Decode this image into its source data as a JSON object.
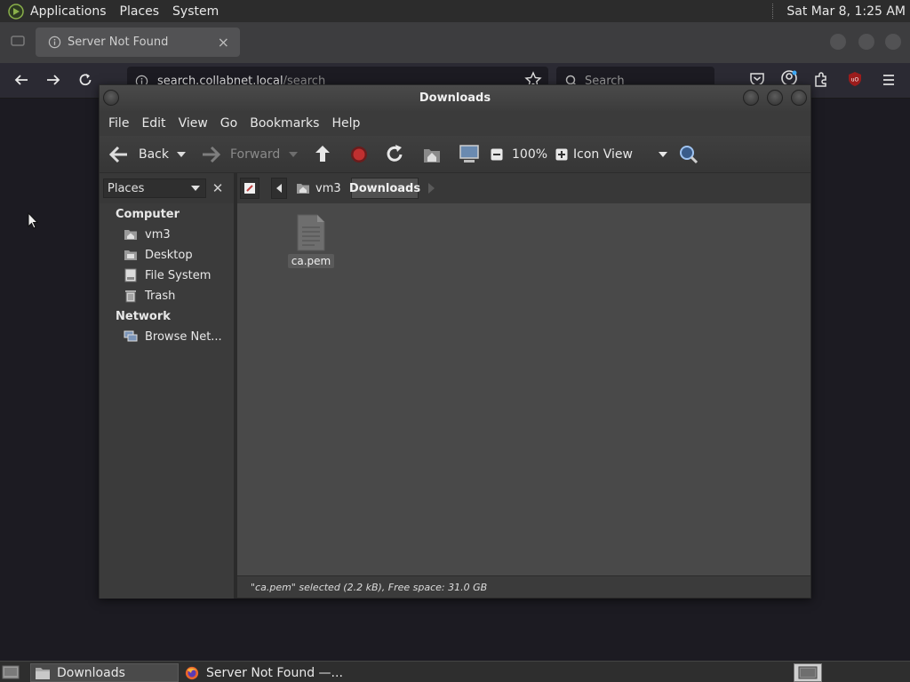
{
  "top_panel": {
    "menus": [
      "Applications",
      "Places",
      "System"
    ],
    "clock": "Sat Mar  8,  1:25 AM"
  },
  "browser": {
    "tab_title": "Server Not Found",
    "tab_close": "×",
    "url_host": "search.collabnet.local",
    "url_path": "/search",
    "search_placeholder": "Search"
  },
  "file_manager": {
    "title": "Downloads",
    "menu": [
      "File",
      "Edit",
      "View",
      "Go",
      "Bookmarks",
      "Help"
    ],
    "toolbar": {
      "back": "Back",
      "forward": "Forward",
      "zoom": "100%",
      "view_mode": "Icon View"
    },
    "side_pane": {
      "selector": "Places",
      "close": "✕",
      "computer_heading": "Computer",
      "computer_items": [
        "vm3",
        "Desktop",
        "File System",
        "Trash"
      ],
      "network_heading": "Network",
      "network_items": [
        "Browse Net..."
      ]
    },
    "breadcrumb": [
      "vm3",
      "Downloads"
    ],
    "files": [
      {
        "name": "ca.pem",
        "icon": "text-document-icon",
        "selected": true
      }
    ],
    "status": "\"ca.pem\" selected (2.2 kB), Free space: 31.0 GB"
  },
  "taskbar": {
    "tasks": [
      "Downloads",
      "Server Not Found —..."
    ]
  }
}
